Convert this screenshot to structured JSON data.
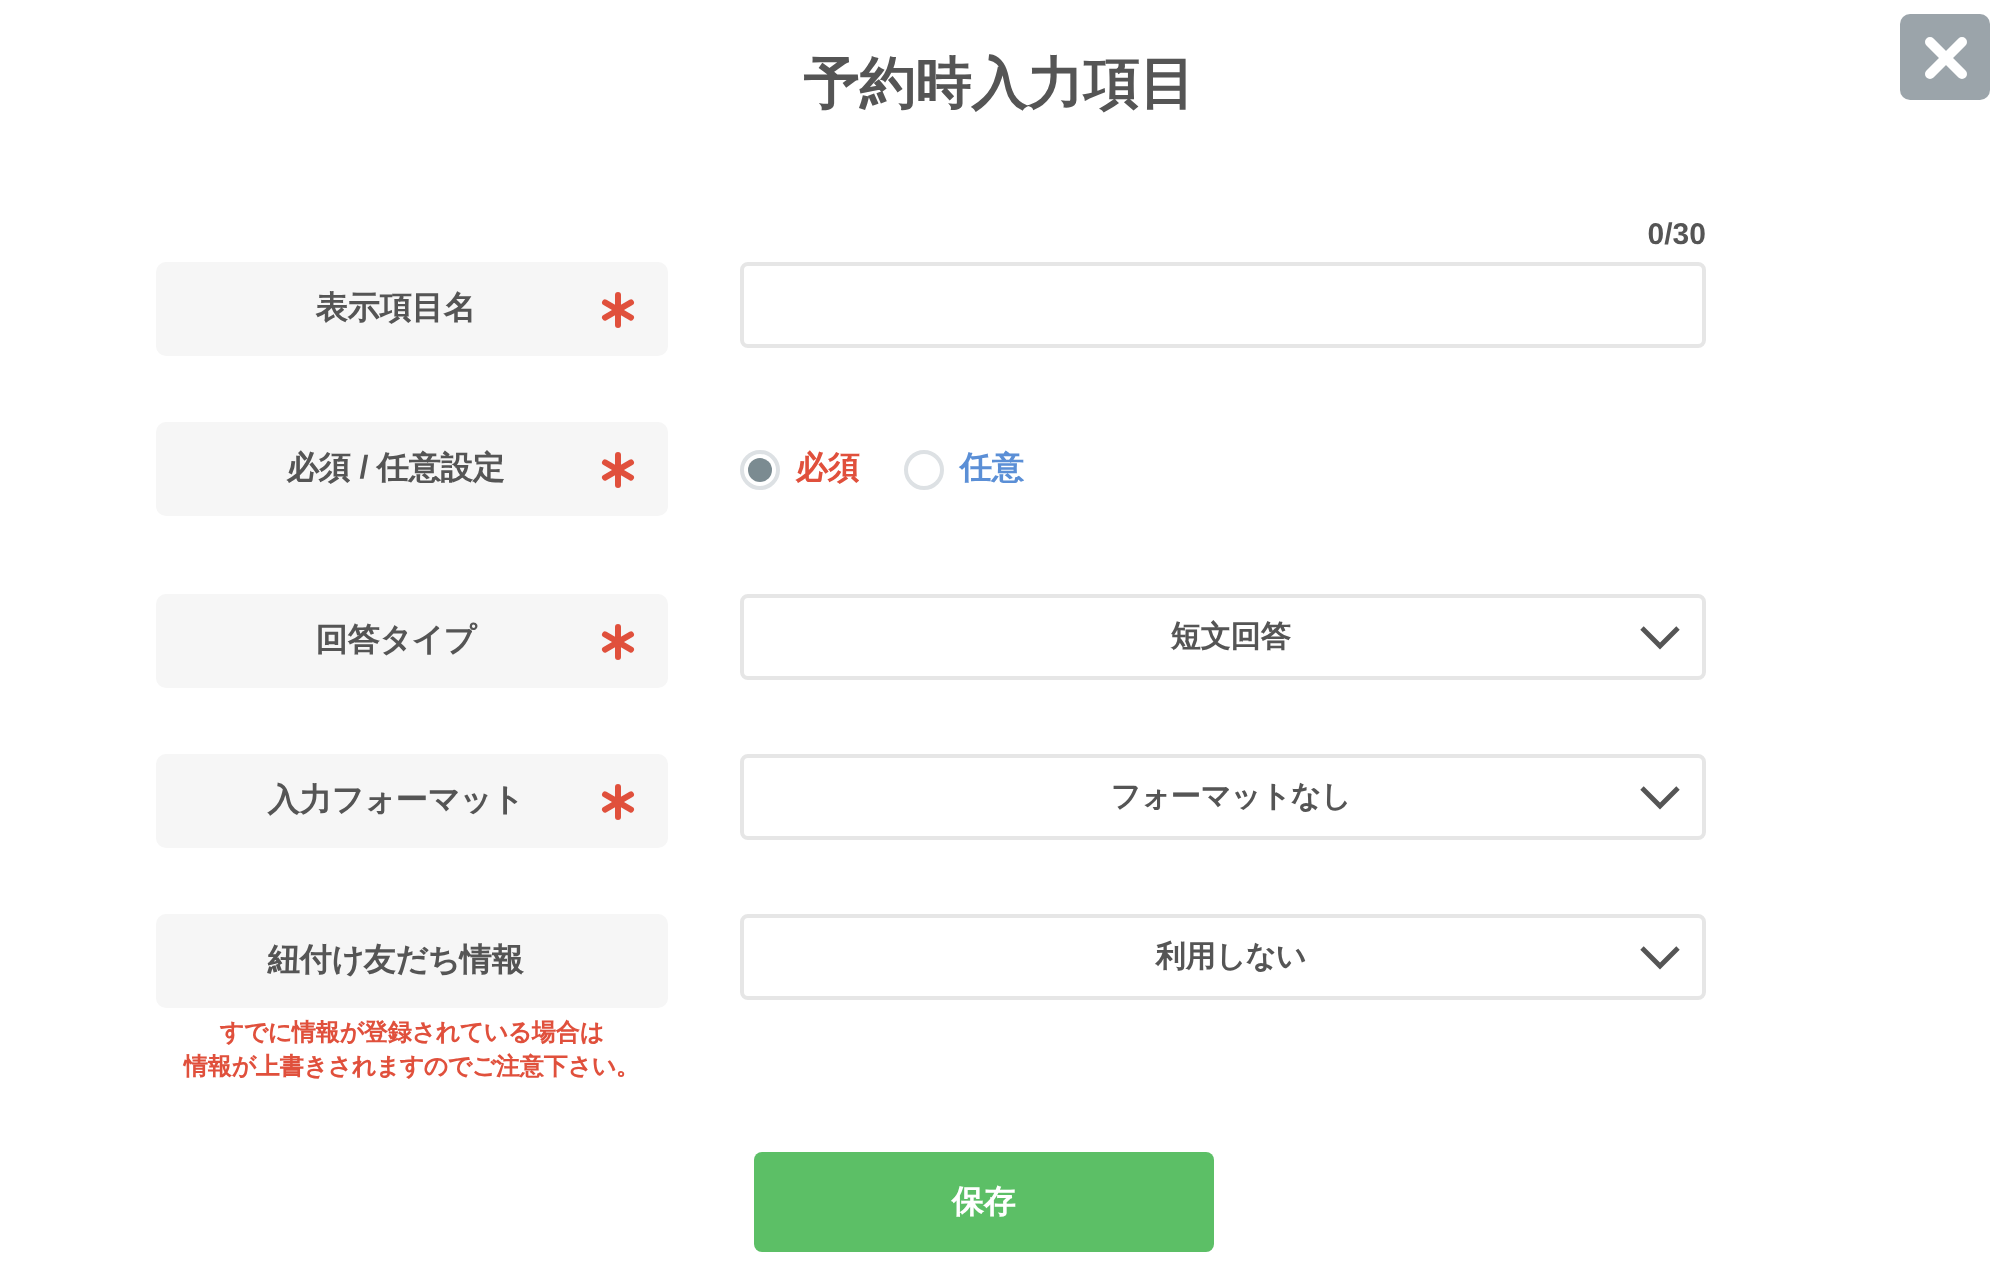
{
  "title": "予約時入力項目",
  "close_button": {
    "kind": "close"
  },
  "fields": [
    {
      "kind": "text",
      "label": "表示項目名",
      "required": true,
      "counter": "0/30"
    },
    {
      "kind": "radio",
      "label": "必須 / 任意設定",
      "required": true,
      "options": [
        {
          "label": "必須",
          "selected": true,
          "color": "#e0503c"
        },
        {
          "label": "任意",
          "selected": false,
          "color": "#5b8fd6"
        }
      ]
    },
    {
      "kind": "select",
      "label": "回答タイプ",
      "required": true,
      "value": "短文回答"
    },
    {
      "kind": "select",
      "label": "入力フォーマット",
      "required": true,
      "value": "フォーマットなし"
    },
    {
      "kind": "select",
      "label": "紐付け友だち情報",
      "required": false,
      "value": "利用しない",
      "note_lines": [
        "すでに情報が登録されている場合は",
        "情報が上書きされますのでご注意下さい。"
      ]
    }
  ],
  "save_button": "保存"
}
